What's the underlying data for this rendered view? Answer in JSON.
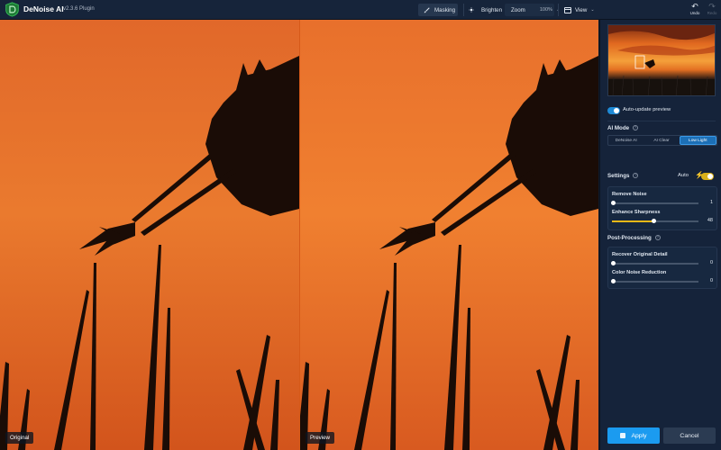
{
  "app": {
    "title": "DeNoise AI",
    "version": "v2.3.6 Plugin",
    "brand_color": "#2fb54a"
  },
  "toolbar": {
    "masking_label": "Masking",
    "brighten_label": "Brighten",
    "zoom_label": "Zoom",
    "zoom_value": "100%",
    "view_label": "View",
    "undo_label": "Undo",
    "redo_label": "Redo"
  },
  "panes": {
    "original_label": "Original",
    "preview_label": "Preview"
  },
  "panel": {
    "auto_update_label": "Auto-update preview",
    "auto_update_on": true,
    "ai_mode_title": "AI Mode",
    "ai_modes": [
      "DeNoise AI",
      "AI Clear",
      "Low Light"
    ],
    "ai_mode_selected": "Low Light",
    "settings_title": "Settings",
    "auto_label": "Auto",
    "settings_sliders": [
      {
        "label": "Remove Noise",
        "value": "1",
        "fraction": 0.01
      },
      {
        "label": "Enhance Sharpness",
        "value": "48",
        "fraction": 0.48
      }
    ],
    "post_processing_title": "Post-Processing",
    "post_sliders": [
      {
        "label": "Recover Original Detail",
        "value": "0",
        "fraction": 0
      },
      {
        "label": "Color Noise Reduction",
        "value": "0",
        "fraction": 0
      }
    ],
    "apply_label": "Apply",
    "cancel_label": "Cancel"
  },
  "colors": {
    "accent_blue": "#1b9bf0",
    "slider_yellow": "#e8b817",
    "sky_orange": "#e8722a"
  }
}
